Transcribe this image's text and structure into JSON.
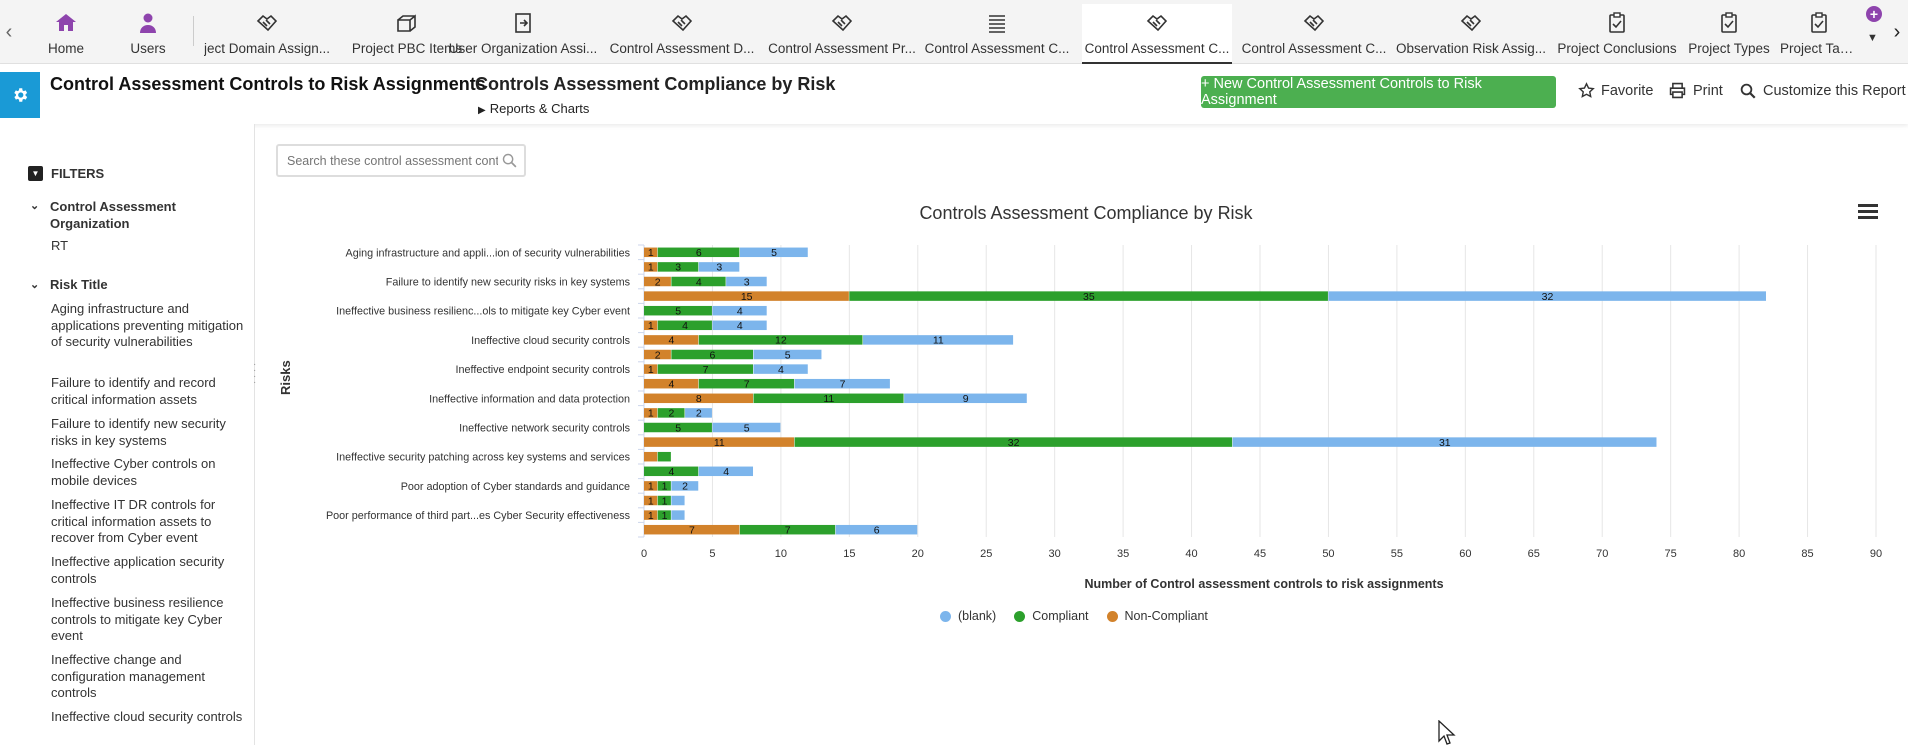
{
  "tabs": [
    {
      "label": "Home",
      "icon": "home-icon"
    },
    {
      "label": "Users",
      "icon": "user-icon"
    },
    {
      "label": "ject Domain Assign...",
      "icon": "handshake-icon"
    },
    {
      "label": "Project PBC Items",
      "icon": "boxes-icon"
    },
    {
      "label": "User Organization Assi...",
      "icon": "arrow-box-icon"
    },
    {
      "label": "Control Assessment D...",
      "icon": "handshake-icon"
    },
    {
      "label": "Control Assessment Pr...",
      "icon": "handshake-icon"
    },
    {
      "label": "Control Assessment C...",
      "icon": "list-icon"
    },
    {
      "label": "Control Assessment C...",
      "icon": "handshake-icon",
      "active": true
    },
    {
      "label": "Control Assessment C...",
      "icon": "handshake-icon"
    },
    {
      "label": "Observation Risk Assig...",
      "icon": "handshake-icon"
    },
    {
      "label": "Project Conclusions",
      "icon": "clipboard-check-icon"
    },
    {
      "label": "Project Types",
      "icon": "clipboard-check-icon"
    },
    {
      "label": "Project Task Li",
      "icon": "clipboard-check-icon"
    }
  ],
  "header": {
    "page_title": "Control Assessment Controls to Risk Assignments",
    "report_title": "Controls Assessment Compliance by Risk",
    "reports_link": "Reports & Charts",
    "new_button": "+ New Control Assessment Controls to Risk Assignment",
    "favorite": "Favorite",
    "print": "Print",
    "customize": "Customize this Report"
  },
  "sidebar": {
    "filters_label": "FILTERS",
    "groups": [
      {
        "title": "Control Assessment Organization",
        "items": [
          "RT"
        ]
      },
      {
        "title": "Risk Title",
        "items": [
          "Aging infrastructure and applications preventing mitigation of security vulnerabilities",
          "Failure to identify and record critical information assets",
          "Failure to identify new security risks in key systems",
          "Ineffective Cyber controls on mobile devices",
          "Ineffective IT DR controls for critical information assets to recover from Cyber event",
          "Ineffective application security controls",
          "Ineffective business resilience controls to mitigate key Cyber event",
          "Ineffective change and configuration management controls",
          "Ineffective cloud security controls"
        ]
      }
    ]
  },
  "search": {
    "placeholder": "Search these control assessment controls"
  },
  "colors": {
    "blank": "#7cb5ec",
    "compliant": "#2ca02c",
    "non_compliant": "#d2822b",
    "accent": "#1a9ad6",
    "new_button": "#4caf50"
  },
  "chart_data": {
    "type": "bar",
    "orientation": "horizontal",
    "stacked": true,
    "title": "Controls Assessment Compliance by Risk",
    "xlabel": "Number of Control assessment controls to risk assignments",
    "ylabel": "Risks",
    "xlim": [
      0,
      90
    ],
    "xticks": [
      0,
      5,
      10,
      15,
      20,
      25,
      30,
      35,
      40,
      45,
      50,
      55,
      60,
      65,
      70,
      75,
      80,
      85,
      90
    ],
    "grid": true,
    "legend_position": "bottom",
    "category_labels": [
      {
        "row": 0,
        "text": "Aging infrastructure and appli...ion of security vulnerabilities"
      },
      {
        "row": 2,
        "text": "Failure to identify new security risks in key systems"
      },
      {
        "row": 4,
        "text": "Ineffective business resilienc...ols to mitigate key Cyber event"
      },
      {
        "row": 6,
        "text": "Ineffective cloud security controls"
      },
      {
        "row": 8,
        "text": "Ineffective endpoint security controls"
      },
      {
        "row": 10,
        "text": "Ineffective information and data protection"
      },
      {
        "row": 12,
        "text": "Ineffective network security controls"
      },
      {
        "row": 14,
        "text": "Ineffective security patching across key systems and services"
      },
      {
        "row": 16,
        "text": "Poor adoption of Cyber standards and guidance"
      },
      {
        "row": 18,
        "text": "Poor performance of third part...es Cyber Security effectiveness"
      }
    ],
    "series": [
      {
        "name": "Non-Compliant",
        "key": "non_compliant",
        "values": [
          1,
          1,
          2,
          15,
          0,
          1,
          4,
          2,
          1,
          4,
          8,
          1,
          0,
          11,
          1,
          0,
          1,
          1,
          1,
          7
        ]
      },
      {
        "name": "Compliant",
        "key": "compliant",
        "values": [
          6,
          3,
          4,
          35,
          5,
          4,
          12,
          6,
          7,
          7,
          11,
          2,
          5,
          32,
          1,
          4,
          1,
          1,
          1,
          7
        ]
      },
      {
        "name": "(blank)",
        "key": "blank",
        "values": [
          5,
          3,
          3,
          32,
          4,
          4,
          11,
          5,
          4,
          7,
          9,
          2,
          5,
          31,
          0,
          4,
          2,
          1,
          1,
          6
        ]
      }
    ],
    "data_labels": [
      {
        "row": 0,
        "series": "non_compliant",
        "label": "1"
      },
      {
        "row": 0,
        "series": "compliant",
        "label": "6"
      },
      {
        "row": 0,
        "series": "blank",
        "label": "5"
      },
      {
        "row": 1,
        "series": "non_compliant",
        "label": "1"
      },
      {
        "row": 1,
        "series": "compliant",
        "label": "3"
      },
      {
        "row": 1,
        "series": "blank",
        "label": "3"
      },
      {
        "row": 2,
        "series": "non_compliant",
        "label": "2"
      },
      {
        "row": 2,
        "series": "compliant",
        "label": "4"
      },
      {
        "row": 2,
        "series": "blank",
        "label": "3"
      },
      {
        "row": 3,
        "series": "non_compliant",
        "label": "15"
      },
      {
        "row": 3,
        "series": "compliant",
        "label": "35"
      },
      {
        "row": 3,
        "series": "blank",
        "label": "32"
      },
      {
        "row": 4,
        "series": "compliant",
        "label": "5"
      },
      {
        "row": 4,
        "series": "blank",
        "label": "4"
      },
      {
        "row": 5,
        "series": "non_compliant",
        "label": "1"
      },
      {
        "row": 5,
        "series": "compliant",
        "label": "4"
      },
      {
        "row": 5,
        "series": "blank",
        "label": "4"
      },
      {
        "row": 6,
        "series": "non_compliant",
        "label": "4"
      },
      {
        "row": 6,
        "series": "compliant",
        "label": "12"
      },
      {
        "row": 6,
        "series": "blank",
        "label": "11"
      },
      {
        "row": 7,
        "series": "non_compliant",
        "label": "2"
      },
      {
        "row": 7,
        "series": "compliant",
        "label": "6"
      },
      {
        "row": 7,
        "series": "blank",
        "label": "5"
      },
      {
        "row": 8,
        "series": "non_compliant",
        "label": "1"
      },
      {
        "row": 8,
        "series": "compliant",
        "label": "7"
      },
      {
        "row": 8,
        "series": "blank",
        "label": "4"
      },
      {
        "row": 9,
        "series": "non_compliant",
        "label": "4"
      },
      {
        "row": 9,
        "series": "compliant",
        "label": "7"
      },
      {
        "row": 9,
        "series": "blank",
        "label": "7"
      },
      {
        "row": 10,
        "series": "non_compliant",
        "label": "8"
      },
      {
        "row": 10,
        "series": "compliant",
        "label": "11"
      },
      {
        "row": 10,
        "series": "blank",
        "label": "9"
      },
      {
        "row": 11,
        "series": "non_compliant",
        "label": "1"
      },
      {
        "row": 11,
        "series": "compliant",
        "label": "2"
      },
      {
        "row": 11,
        "series": "blank",
        "label": "2"
      },
      {
        "row": 12,
        "series": "compliant",
        "label": "5"
      },
      {
        "row": 12,
        "series": "blank",
        "label": "5"
      },
      {
        "row": 13,
        "series": "non_compliant",
        "label": "11"
      },
      {
        "row": 13,
        "series": "compliant",
        "label": "32"
      },
      {
        "row": 13,
        "series": "blank",
        "label": "31"
      },
      {
        "row": 15,
        "series": "compliant",
        "label": "4"
      },
      {
        "row": 15,
        "series": "blank",
        "label": "4"
      },
      {
        "row": 16,
        "series": "non_compliant",
        "label": "1"
      },
      {
        "row": 16,
        "series": "compliant",
        "label": "1"
      },
      {
        "row": 16,
        "series": "blank",
        "label": "2"
      },
      {
        "row": 17,
        "series": "non_compliant",
        "label": "1"
      },
      {
        "row": 17,
        "series": "compliant",
        "label": "1"
      },
      {
        "row": 18,
        "series": "non_compliant",
        "label": "1"
      },
      {
        "row": 18,
        "series": "compliant",
        "label": "1"
      },
      {
        "row": 19,
        "series": "non_compliant",
        "label": "7"
      },
      {
        "row": 19,
        "series": "compliant",
        "label": "7"
      },
      {
        "row": 19,
        "series": "blank",
        "label": "6"
      }
    ],
    "legend": [
      {
        "name": "(blank)",
        "key": "blank"
      },
      {
        "name": "Compliant",
        "key": "compliant"
      },
      {
        "name": "Non-Compliant",
        "key": "non_compliant"
      }
    ]
  }
}
